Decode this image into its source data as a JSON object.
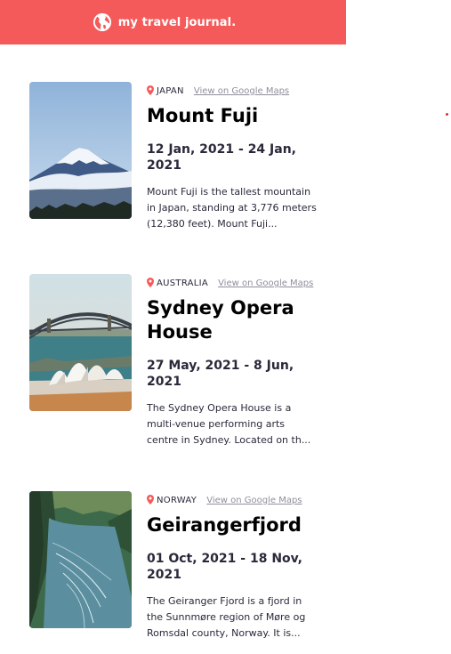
{
  "header": {
    "brand": "my travel journal.",
    "logo_icon": "globe-icon",
    "color": "#F55A5A"
  },
  "entries": [
    {
      "country": "JAPAN",
      "map_link": "View on Google Maps",
      "title": "Mount Fuji",
      "dates": "12 Jan, 2021 - 24 Jan, 2021",
      "description": "Mount Fuji is the tallest mountain in Japan, standing at 3,776 meters (12,380 feet). Mount Fuji...",
      "image_icon": "mount-fuji-photo"
    },
    {
      "country": "AUSTRALIA",
      "map_link": "View on Google Maps",
      "title": "Sydney Opera House",
      "dates": "27 May, 2021 - 8 Jun, 2021",
      "description": "The Sydney Opera House is a multi-venue performing arts centre in Sydney. Located on th...",
      "image_icon": "sydney-opera-house-photo"
    },
    {
      "country": "NORWAY",
      "map_link": "View on Google Maps",
      "title": "Geirangerfjord",
      "dates": "01 Oct, 2021 - 18 Nov, 2021",
      "description": "The Geiranger Fjord is a fjord in the Sunnmøre region of Møre og Romsdal county, Norway. It is...",
      "image_icon": "geirangerfjord-photo"
    }
  ],
  "colors": {
    "pin": "#F55A5A",
    "text": "#2B283A",
    "link": "#918E9B"
  }
}
